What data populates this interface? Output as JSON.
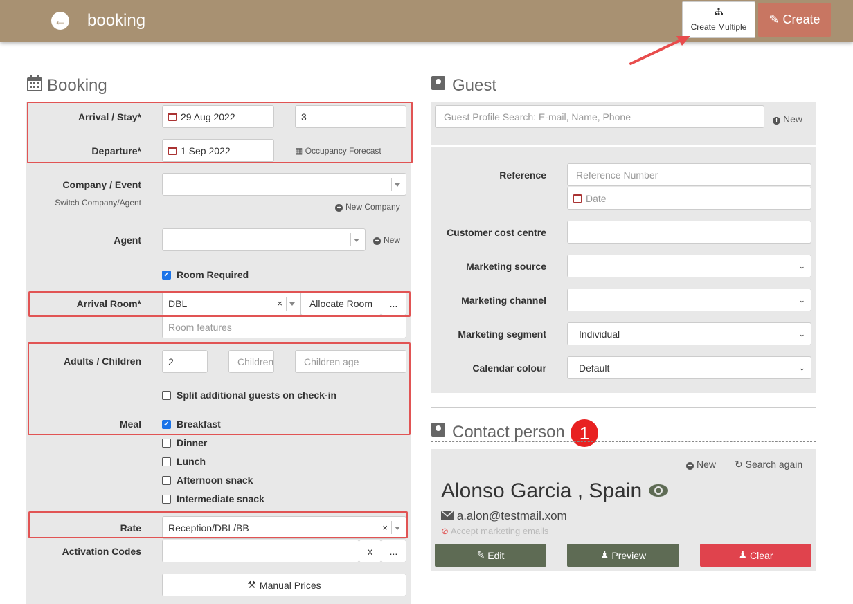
{
  "header": {
    "title": "booking",
    "create_multiple": "Create Multiple",
    "create": "Create"
  },
  "booking": {
    "section_title": "Booking",
    "arrival_label": "Arrival / Stay*",
    "arrival_date": "29 Aug 2022",
    "stay_nights": "3",
    "departure_label": "Departure*",
    "departure_date": "1 Sep 2022",
    "occupancy_forecast": "Occupancy Forecast",
    "company_label": "Company / Event",
    "switch_company": "Switch Company/Agent",
    "new_company": "New Company",
    "agent_label": "Agent",
    "agent_new": "New",
    "room_required": "Room Required",
    "arrival_room_label": "Arrival Room*",
    "arrival_room_value": "DBL",
    "allocate_room": "Allocate Room",
    "more": "...",
    "room_features_placeholder": "Room features",
    "adults_children_label": "Adults / Children",
    "adults": "2",
    "children_placeholder": "Children",
    "children_age_placeholder": "Children age",
    "split_guests": "Split additional guests on check-in",
    "meal_label": "Meal",
    "meals": [
      {
        "label": "Breakfast",
        "checked": true
      },
      {
        "label": "Dinner",
        "checked": false
      },
      {
        "label": "Lunch",
        "checked": false
      },
      {
        "label": "Afternoon snack",
        "checked": false
      },
      {
        "label": "Intermediate snack",
        "checked": false
      }
    ],
    "rate_label": "Rate",
    "rate_value": "Reception/DBL/BB",
    "activation_codes_label": "Activation Codes",
    "clear_x": "x",
    "manual_prices": "Manual Prices"
  },
  "guest": {
    "section_title": "Guest",
    "search_placeholder": "Guest Profile Search: E-mail, Name, Phone",
    "new": "New",
    "reference_label": "Reference",
    "reference_placeholder": "Reference Number",
    "date_placeholder": "Date",
    "cost_centre_label": "Customer cost centre",
    "marketing_source_label": "Marketing source",
    "marketing_channel_label": "Marketing channel",
    "marketing_segment_label": "Marketing segment",
    "marketing_segment_value": "Individual",
    "calendar_colour_label": "Calendar colour",
    "calendar_colour_value": "Default"
  },
  "contact": {
    "section_title": "Contact person",
    "badge": "1",
    "new": "New",
    "search_again": "Search again",
    "name": "Alonso Garcia , Spain",
    "email": "a.alon@testmail.xom",
    "marketing": "Accept marketing emails",
    "edit": "Edit",
    "preview": "Preview",
    "clear": "Clear"
  },
  "colors": {
    "topbar": "#a89172",
    "create_button": "#c87662",
    "highlight": "#e15454",
    "dark_button": "#5e6b54",
    "danger_button": "#e0434d"
  }
}
